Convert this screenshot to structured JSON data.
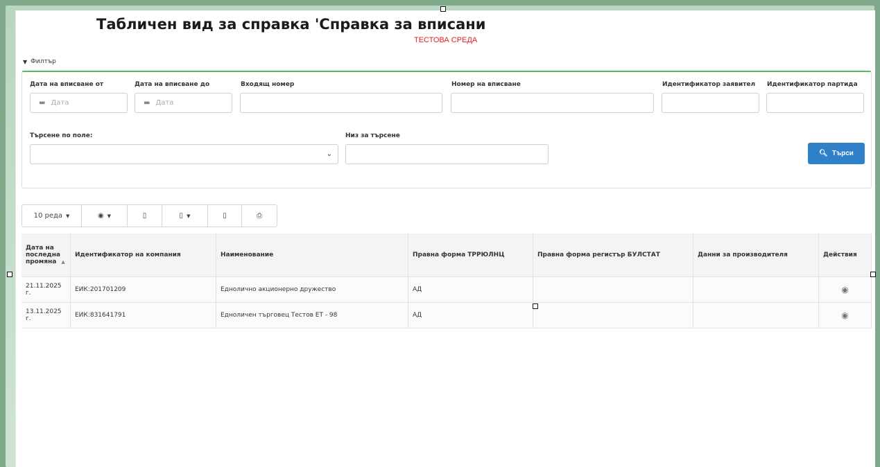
{
  "page": {
    "title": "Табличен вид за справка 'Справка за вписани",
    "environment_label": "ТЕСТОВА СРЕДА"
  },
  "filter": {
    "toggle_label": "Филтър",
    "fields": {
      "date_from_label": "Дата на вписване от",
      "date_from_placeholder": "Дата",
      "date_to_label": "Дата на вписване до",
      "date_to_placeholder": "Дата",
      "incoming_number_label": "Входящ номер",
      "registration_number_label": "Номер на вписване",
      "applicant_id_label": "Идентификатор заявител",
      "batch_id_label": "Идентификатор партида",
      "search_by_field_label": "Търсене по поле:",
      "search_string_label": "Низ за търсене"
    },
    "search_button_label": "Търси"
  },
  "toolbar": {
    "rows_label": "10 реда"
  },
  "table": {
    "headers": [
      "Дата на последна промяна",
      "Идентификатор на компания",
      "Наименование",
      "Правна форма ТРРЮЛНЦ",
      "Правна форма регистър БУЛСТАТ",
      "Данни за производителя",
      "Действия"
    ],
    "rows": [
      [
        "21.11.2025 г.",
        "ЕИК:201701209",
        "Еднолично акционерно дружество",
        "АД",
        "",
        ""
      ],
      [
        "13.11.2025 г.",
        "ЕИК:831641791",
        "Едноличен търговец Тестов ЕТ - 98",
        "АД",
        "",
        ""
      ]
    ]
  },
  "icons": {
    "calendar": "calendar-icon",
    "search": "search-icon",
    "eye": "eye-icon",
    "excel": "excel-icon",
    "pdf": "pdf-icon",
    "file": "file-icon",
    "print": "print-icon"
  },
  "colors": {
    "accent_green": "#5cb85c",
    "button_blue": "#2f7fc9",
    "env_red": "#e02020"
  }
}
